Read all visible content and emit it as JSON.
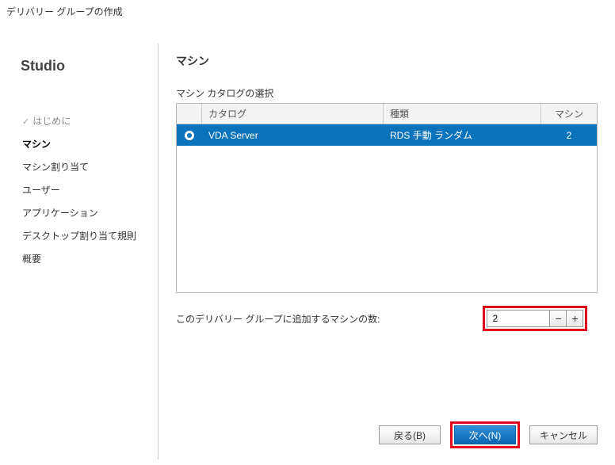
{
  "window_title": "デリバリー グループの作成",
  "brand": "Studio",
  "nav": {
    "items": [
      {
        "label": "はじめに",
        "state": "done"
      },
      {
        "label": "マシン",
        "state": "current"
      },
      {
        "label": "マシン割り当て",
        "state": "todo"
      },
      {
        "label": "ユーザー",
        "state": "todo"
      },
      {
        "label": "アプリケーション",
        "state": "todo"
      },
      {
        "label": "デスクトップ割り当て規則",
        "state": "todo"
      },
      {
        "label": "概要",
        "state": "todo"
      }
    ]
  },
  "page": {
    "heading": "マシン",
    "catalog_select_label": "マシン カタログの選択",
    "columns": {
      "catalog": "カタログ",
      "type": "種類",
      "count": "マシン"
    },
    "rows": [
      {
        "selected": true,
        "catalog": "VDA Server",
        "type": "RDS 手動 ランダム",
        "count": "2"
      }
    ],
    "qty_label": "このデリバリー グループに追加するマシンの数:",
    "qty_value": "2"
  },
  "buttons": {
    "back": "戻る(B)",
    "next": "次へ(N)",
    "cancel": "キャンセル",
    "minus": "−",
    "plus": "+"
  }
}
